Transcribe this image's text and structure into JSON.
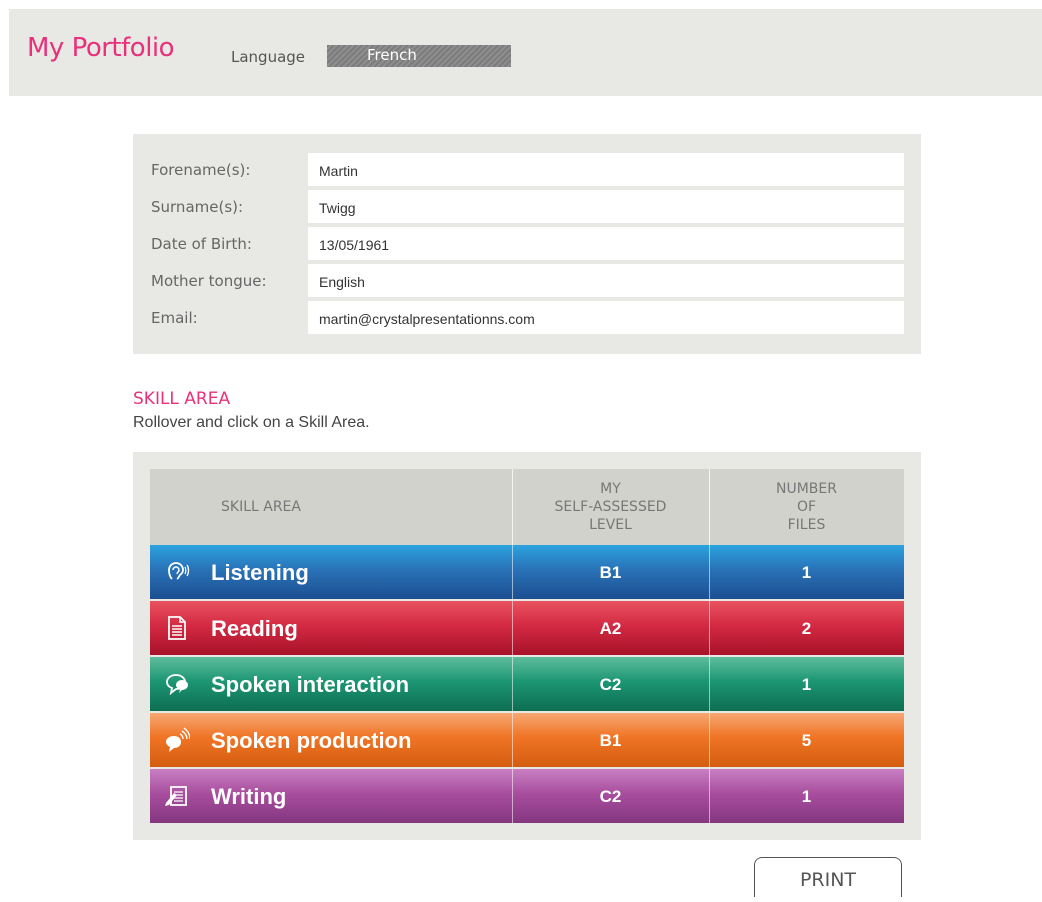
{
  "header": {
    "title": "My Portfolio",
    "language_label": "Language",
    "language_value": "French"
  },
  "profile": {
    "fields": [
      {
        "label": "Forename(s):",
        "value": "Martin"
      },
      {
        "label": "Surname(s):",
        "value": "Twigg"
      },
      {
        "label": "Date of Birth:",
        "value": "13/05/1961"
      },
      {
        "label": "Mother tongue:",
        "value": "English"
      },
      {
        "label": "Email:",
        "value": "martin@crystalpresentationns.com"
      }
    ]
  },
  "skills": {
    "heading": "SKILL AREA",
    "instruction": "Rollover and click on a Skill Area.",
    "columns": {
      "area": "SKILL AREA",
      "level": "MY\nSELF-ASSESSED\nLEVEL",
      "files": "NUMBER\nOF\nFILES"
    },
    "rows": [
      {
        "name": "Listening",
        "icon": "ear-icon",
        "level": "B1",
        "files": "1",
        "color_top": "#2ba3df",
        "color_mid": "#2a72b8",
        "color_bottom": "#1c4f91"
      },
      {
        "name": "Reading",
        "icon": "document-icon",
        "level": "A2",
        "files": "2",
        "color_top": "#e8535f",
        "color_mid": "#d42a43",
        "color_bottom": "#a8122a"
      },
      {
        "name": "Spoken interaction",
        "icon": "speech-bubbles-icon",
        "level": "C2",
        "files": "1",
        "color_top": "#5fbd9c",
        "color_mid": "#1c9673",
        "color_bottom": "#0e6e52"
      },
      {
        "name": "Spoken production",
        "icon": "speaker-sound-icon",
        "level": "B1",
        "files": "5",
        "color_top": "#f6a874",
        "color_mid": "#f07424",
        "color_bottom": "#d45d10"
      },
      {
        "name": "Writing",
        "icon": "writing-icon",
        "level": "C2",
        "files": "1",
        "color_top": "#c87fc3",
        "color_mid": "#a84e9e",
        "color_bottom": "#843780"
      }
    ]
  },
  "actions": {
    "print_label": "PRINT"
  }
}
